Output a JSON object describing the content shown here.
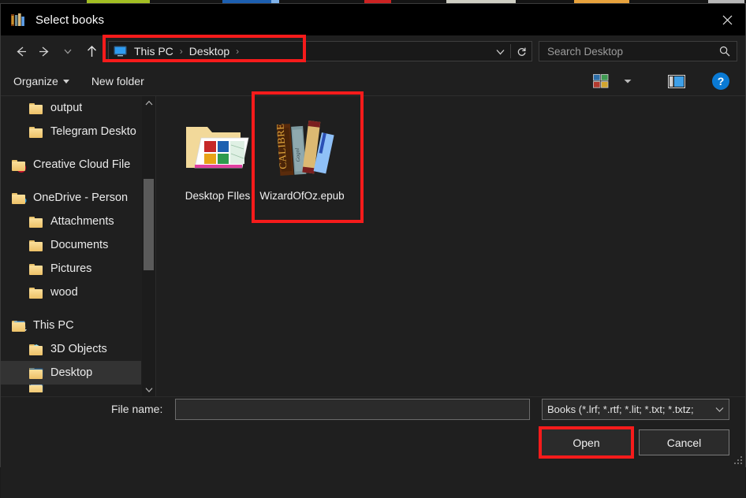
{
  "window": {
    "title": "Select books",
    "title_icon": "books-icon",
    "close_icon": "close-icon"
  },
  "navigation": {
    "back_icon": "arrow-left-icon",
    "forward_icon": "arrow-right-icon",
    "recent_icon": "chevron-down-icon",
    "up_icon": "arrow-up-icon",
    "address": {
      "computer_icon": "monitor-icon",
      "crumbs": [
        "This PC",
        "Desktop"
      ],
      "separator": "›",
      "history_icon": "chevron-down-icon",
      "refresh_icon": "refresh-icon"
    },
    "search": {
      "value": "",
      "placeholder": "Search Desktop",
      "icon": "search-icon"
    }
  },
  "toolbar": {
    "organize_label": "Organize",
    "new_folder_label": "New folder",
    "view_icon": "tiles-view-icon",
    "view_caret_icon": "chevron-down-icon",
    "preview_icon": "preview-pane-icon",
    "help_label": "?",
    "help_icon": "help-icon"
  },
  "sidebar": {
    "items": [
      {
        "label": "output",
        "icon": "folder-icon",
        "indent": 1,
        "selected": false
      },
      {
        "label": "Telegram Deskto",
        "icon": "folder-icon",
        "indent": 1,
        "selected": false
      },
      {
        "label": "Creative Cloud File",
        "icon": "creative-cloud-icon",
        "indent": 0,
        "selected": false
      },
      {
        "label": "OneDrive - Person",
        "icon": "onedrive-icon",
        "indent": 0,
        "selected": false
      },
      {
        "label": "Attachments",
        "icon": "folder-icon",
        "indent": 1,
        "selected": false
      },
      {
        "label": "Documents",
        "icon": "folder-icon",
        "indent": 1,
        "selected": false
      },
      {
        "label": "Pictures",
        "icon": "folder-icon",
        "indent": 1,
        "selected": false
      },
      {
        "label": "wood",
        "icon": "folder-icon",
        "indent": 1,
        "selected": false
      },
      {
        "label": "This PC",
        "icon": "this-pc-icon",
        "indent": 0,
        "selected": false
      },
      {
        "label": "3D Objects",
        "icon": "3d-objects-icon",
        "indent": 1,
        "selected": false
      },
      {
        "label": "Desktop",
        "icon": "monitor-icon",
        "indent": 1,
        "selected": true
      }
    ],
    "scroll_up_icon": "chevron-up-icon",
    "scroll_down_icon": "chevron-down-icon"
  },
  "files": [
    {
      "name": "Desktop FIles",
      "icon": "folder-open-pictures-icon",
      "selected": false
    },
    {
      "name": "WizardOfOz.epub",
      "icon": "calibre-books-icon",
      "selected": false
    }
  ],
  "footer": {
    "file_name_label": "File name:",
    "file_name_value": "",
    "file_type_value": "Books (*.lrf; *.rtf; *.lit; *.txt; *.txtz;",
    "file_type_caret_icon": "chevron-down-icon",
    "open_label": "Open",
    "cancel_label": "Cancel",
    "resize_grip_icon": "resize-grip-icon"
  },
  "annotations": {
    "accent_color": "#f61b1b",
    "boxes": [
      "address-bar",
      "wizardofoz-file",
      "open-button"
    ]
  },
  "colors": {
    "window_bg": "#1f1f1f",
    "titlebar_bg": "#000000",
    "selected_row": "#333333",
    "help_blue": "#0a7ad4",
    "folder_yellow": "#edc168"
  }
}
